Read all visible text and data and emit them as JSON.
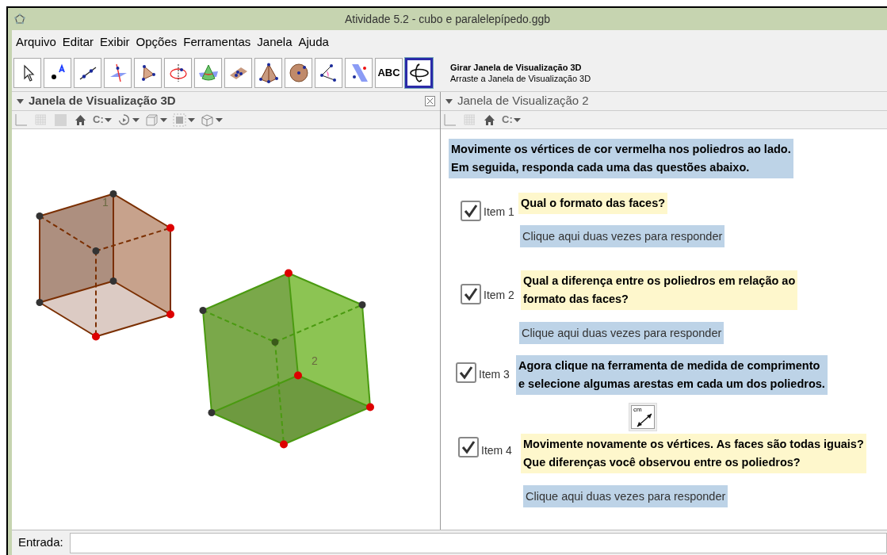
{
  "window": {
    "title": "Atividade 5.2 - cubo e paralelepípedo.ggb"
  },
  "menu": [
    "Arquivo",
    "Editar",
    "Exibir",
    "Opções",
    "Ferramentas",
    "Janela",
    "Ajuda"
  ],
  "toolbar": {
    "tools": [
      {
        "kind": "move",
        "selected": false
      },
      {
        "kind": "point",
        "selected": false
      },
      {
        "kind": "line",
        "selected": false
      },
      {
        "kind": "perpendicular",
        "selected": false
      },
      {
        "kind": "polygon",
        "selected": false
      },
      {
        "kind": "rotate-axis",
        "selected": false
      },
      {
        "kind": "cone",
        "selected": false
      },
      {
        "kind": "plane",
        "selected": false
      },
      {
        "kind": "pyramid",
        "selected": false
      },
      {
        "kind": "sphere",
        "selected": false
      },
      {
        "kind": "angle",
        "selected": false
      },
      {
        "kind": "parallel-plane",
        "selected": false
      },
      {
        "kind": "text",
        "label": "ABC",
        "selected": false
      },
      {
        "kind": "rotate-view",
        "selected": true
      }
    ],
    "help_title": "Girar Janela de Visualização 3D",
    "help_text": "Arraste a Janela de Visualização 3D"
  },
  "view_3d": {
    "title": "Janela de Visualização 3D",
    "style_bar": [
      {
        "kind": "axes"
      },
      {
        "kind": "grid"
      },
      {
        "kind": "background"
      },
      {
        "kind": "home"
      },
      {
        "kind": "text",
        "label": "C:"
      },
      {
        "kind": "rotate"
      },
      {
        "kind": "cube"
      },
      {
        "kind": "clip"
      },
      {
        "kind": "box"
      }
    ],
    "labels": [
      "1",
      "2"
    ]
  },
  "view_2": {
    "title": "Janela de Visualização 2",
    "style_bar": [
      {
        "kind": "axes"
      },
      {
        "kind": "grid"
      },
      {
        "kind": "home"
      },
      {
        "kind": "text",
        "label": "C:"
      }
    ],
    "intro": "Movimente os vértices de cor vermelha nos poliedros ao lado.\nEm seguida, responda cada uma das questões abaixo.",
    "items": [
      {
        "label": "Item 1",
        "checked": true,
        "question": "Qual o formato das faces?",
        "color": "#fef7cc",
        "answer": "Clique aqui duas vezes para responder"
      },
      {
        "label": "Item 2",
        "checked": true,
        "question": "Qual a diferença entre os poliedros em relação ao\nformato das faces?",
        "color": "#fef7cc",
        "answer": "Clique aqui duas vezes para responder"
      },
      {
        "label": "Item 3",
        "checked": true,
        "question": "Agora clique na ferramenta de medida de comprimento\ne selecione algumas arestas em cada um dos poliedros.",
        "color": "#bdd3e7"
      },
      {
        "label": "Item 4",
        "checked": true,
        "question": "Movimente novamente os vértices. As faces são todas iguais?\nQue diferenças você observou entre os poliedros?",
        "color": "#fef7cc",
        "answer": "Clique aqui duas vezes para responder"
      }
    ],
    "tool_button": {
      "label": "cm"
    }
  },
  "input_bar": {
    "label": "Entrada:"
  }
}
